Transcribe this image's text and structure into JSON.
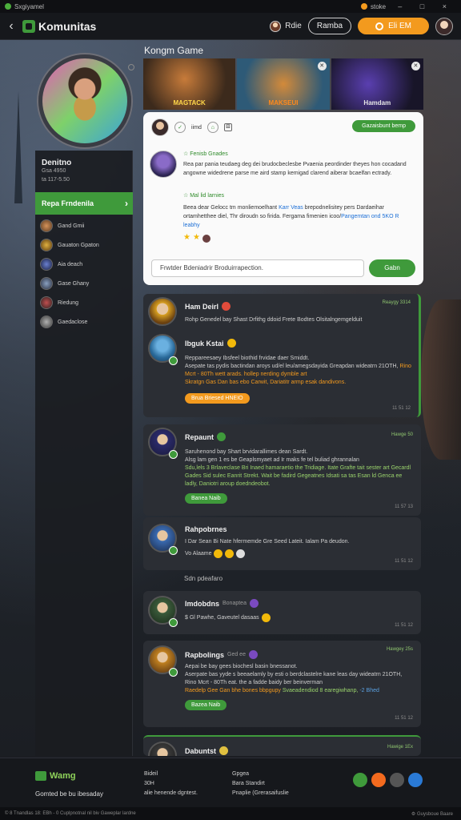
{
  "os": {
    "tab1": "Sxgiyamel",
    "tab2": "stoke",
    "window_controls": "– □ ×"
  },
  "header": {
    "title": "Komunitas",
    "user_label": "Rdie",
    "btn_outline": "Ramba",
    "btn_primary": "Eli EM"
  },
  "sidebar": {
    "name": "Denitno",
    "sub1": "Gsa 4950",
    "sub2": "ta 117-5.50",
    "active_item": "Repa Frndenila",
    "items": [
      "Gand Gmii",
      "Gauaton Gpaton",
      "Aia deach",
      "Gase Ghany",
      "Riedung",
      "Gaedaclose"
    ]
  },
  "main": {
    "title": "Kongm Game",
    "banner": [
      "MAGTACK",
      "MAKSEUI",
      "Hamdam"
    ],
    "post": {
      "meta_user": "iimd",
      "follow_btn": "Gazaisbunt bemp",
      "heading1": "☆ Fenisb Gnades",
      "text1": "Rea par pania teudaeg deg dei brudocbeclesbe Pvaenia peordinder theyes hon cocadand angowne widedrene parse me aird stamp kemigad clarend aiberar bcaelfan ectrady.",
      "heading2": "☆ Mal lid larnies",
      "text2a": "Beea dear Gelocc tm monliemoelhant ",
      "text2_link1": "Karr Veas",
      "text2b": " brepodnelisitey pers Dardaeihar ortamhetthee diel, Thr diroudn so firida. Fergama fimenien icoo/",
      "text2_link2": "Pangemtan ond 5KO R leabhy",
      "input_placeholder": "Frwtder Bdeniadrir Broduirrapection.",
      "send_btn": "Gabn"
    }
  },
  "feed": [
    {
      "name": "Ham Deirl",
      "time": "Reaygy 3314",
      "text": "Rohp Genedel bay Shast Drfithg ddoid Frete Bodtes Olsitalngemgelduit"
    },
    {
      "name": "Ibguk Kstai",
      "text_a": "Reppareesaey Ibsfeel biothid frvidae daer Smiddt.",
      "text_b": "Asepate tas pydis bactindan aroys ud/el leu/amegsdayida Greapdan wideatrn 21OTH, ",
      "text_b_hl": "Rino Mcrt - 80Th wett arads. hollep nerding dymble art",
      "text_c": "Skratgn Gas Dan bas ebo Carwit, Dariatitr armp esak dandivons.",
      "pill": "Brua Briesed HNEIO",
      "stamp": "11 51 12"
    },
    {
      "name": "Repaunt",
      "time": "Hawge 50",
      "text": "Saruhenond bay Shart brvidarallimes dean Sardt.",
      "text2": "Alsg lam gen 1 es be Geaplsmyaet ad Ir maks fe tel buliad ghrannalan",
      "text3": "Sdu,lels 3 Brlaveclase Bri Inaed hamaraetio the Tridiage. Itate Grafte tait sester art Gecardl Gades Sid sulec Eanrit Strekt. Wait be fadird Gegeatnes Idsati sa tas Esan ld Genca ee ladly, Daniotri aroup doedndeobot.",
      "pill": "Banea Naib",
      "stamp": "11 57 13"
    },
    {
      "name": "Rahpobrnes",
      "text": "I Dar Sean Bi Nate hfermemde Gre Seed Lateit. Ialam Pa deudon.",
      "text2": "Vo Alaame",
      "stamp": "11 51 12"
    }
  ],
  "section_label": "Sdn pdeafaro",
  "feed2": [
    {
      "name": "Imdobdns",
      "sub": "Bonaptea",
      "text": "$ Gl Pawhe, Gaveutel dasaas",
      "stamp": "11 51 12"
    },
    {
      "name": "Rapbolings",
      "sub": "Ged ee",
      "time": "Hawgey 25s",
      "text": "Aepai be bay gees biochesl basin bnessanot.",
      "text2": "Aserpate bas yyde s beeaelamly by esti o berdclastelre kane leas day wideatrn 21OTH, Rino Mcrt - 80Th eat. the a fadde baidy ber beinverman",
      "text3": "Raedelp Gee Gan bhe bones bbpgupy ",
      "text3_hl": "Svaeadendiod 8 earegiwhanp,",
      "text3_link": " -2 Bhed",
      "pill": "Bazea Naib",
      "stamp": "11 51 12"
    },
    {
      "name": "Dabuntst",
      "time": "Hawige 1Ex"
    }
  ],
  "footer": {
    "brand": "Wamg",
    "sub": "Gomted be bu ibesaday",
    "col1": [
      "Bideil",
      "30H",
      "alie henende dgntest."
    ],
    "col2": [
      "Gpgea",
      "Bara Standirt",
      "Pnaplie (Grerasaifuslie"
    ],
    "copyright": "© 8 Tnandlas 18: EBh - 0 Cuplpnotnal nil biv Gaweplar lardne",
    "copyright_right": "⚙ Guysboue Baare"
  }
}
